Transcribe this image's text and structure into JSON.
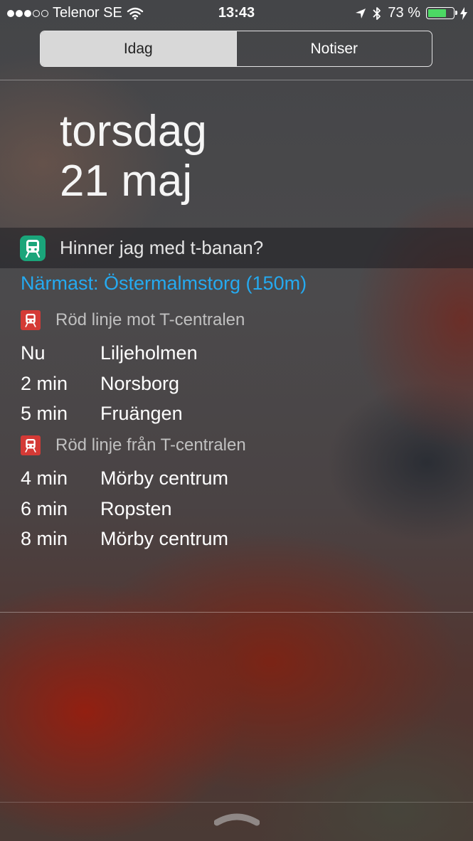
{
  "status_bar": {
    "carrier": "Telenor SE",
    "time": "13:43",
    "battery": "73 %",
    "battery_level": 0.73,
    "signal_bars_filled": 3,
    "signal_bars_total": 5
  },
  "tabs": [
    {
      "label": "Idag",
      "active": true
    },
    {
      "label": "Notiser",
      "active": false
    }
  ],
  "date": {
    "weekday": "torsdag",
    "day_month": "21 maj"
  },
  "widget": {
    "title": "Hinner jag med t-banan?",
    "icon": "train-icon",
    "nearest": "Närmast: Östermalmstorg (150m)",
    "accent_color": "#25aaf0",
    "line_color": "#d43a36",
    "groups": [
      {
        "title": "Röd linje mot T-centralen",
        "departures": [
          {
            "time": "Nu",
            "destination": "Liljeholmen"
          },
          {
            "time": "2 min",
            "destination": "Norsborg"
          },
          {
            "time": "5 min",
            "destination": "Fruängen"
          }
        ]
      },
      {
        "title": "Röd linje från T-centralen",
        "departures": [
          {
            "time": "4 min",
            "destination": "Mörby centrum"
          },
          {
            "time": "6 min",
            "destination": "Ropsten"
          },
          {
            "time": "8 min",
            "destination": "Mörby centrum"
          }
        ]
      }
    ]
  }
}
